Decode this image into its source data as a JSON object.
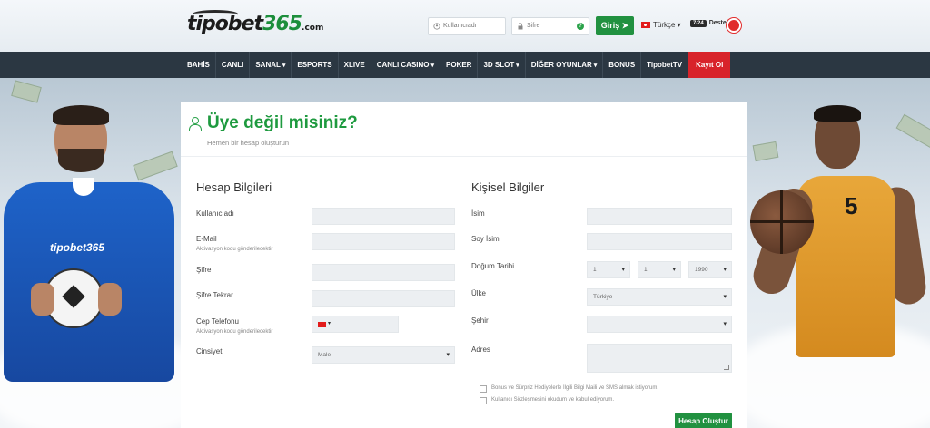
{
  "header": {
    "logo": {
      "brand": "tipobet",
      "number": "365",
      "domain": ".com"
    },
    "username_placeholder": "Kullanıcıadı",
    "password_placeholder": "Şifre",
    "password_help": "?",
    "login_button": "Giriş",
    "login_icon": "arrow-circle-right-icon",
    "language": "Türkçe",
    "support_badge": "7/24",
    "support_label": "Destek"
  },
  "nav": {
    "items": [
      {
        "label": "BAHİS",
        "dropdown": false
      },
      {
        "label": "CANLI",
        "dropdown": false
      },
      {
        "label": "SANAL",
        "dropdown": true
      },
      {
        "label": "ESPORTS",
        "dropdown": false
      },
      {
        "label": "XLIVE",
        "dropdown": false
      },
      {
        "label": "CANLI CASINO",
        "dropdown": true
      },
      {
        "label": "POKER",
        "dropdown": false
      },
      {
        "label": "3D SLOT",
        "dropdown": true
      },
      {
        "label": "DİĞER OYUNLAR",
        "dropdown": true
      },
      {
        "label": "BONUS",
        "dropdown": false
      },
      {
        "label": "TipobetTV",
        "dropdown": false
      }
    ],
    "register": "Kayıt Ol",
    "register_color": "#d8232a"
  },
  "panel": {
    "title": "Üye değil misiniz?",
    "subtitle": "Hemen bir hesap oluşturun"
  },
  "account": {
    "title": "Hesap Bilgileri",
    "username": "Kullanıcıadı",
    "email": "E-Mail",
    "email_hint": "Aktivasyon kodu gönderilecektir",
    "password": "Şifre",
    "password_repeat": "Şifre Tekrar",
    "phone": "Cep Telefonu",
    "phone_hint": "Aktivasyon kodu gönderilecektir",
    "gender": "Cinsiyet",
    "gender_value": "Male"
  },
  "personal": {
    "title": "Kişisel Bilgiler",
    "name": "İsim",
    "surname": "Soy İsim",
    "birthdate": "Doğum Tarihi",
    "day": "1",
    "month": "1",
    "year": "1990",
    "country": "Ülke",
    "country_value": "Türkiye",
    "city": "Şehir",
    "address": "Adres",
    "consent_bonus": "Bonus ve Sürpriz Hediyelerle İlgili Bilgi Maili ve SMS almak istiyorum.",
    "consent_terms": "Kullanıcı Sözleşmesini okudum ve kabul ediyorum.",
    "submit": "Hesap Oluştur"
  },
  "colors": {
    "accent_green": "#219140",
    "nav_bg": "#2b3742",
    "title_green": "#1e9a3f"
  }
}
